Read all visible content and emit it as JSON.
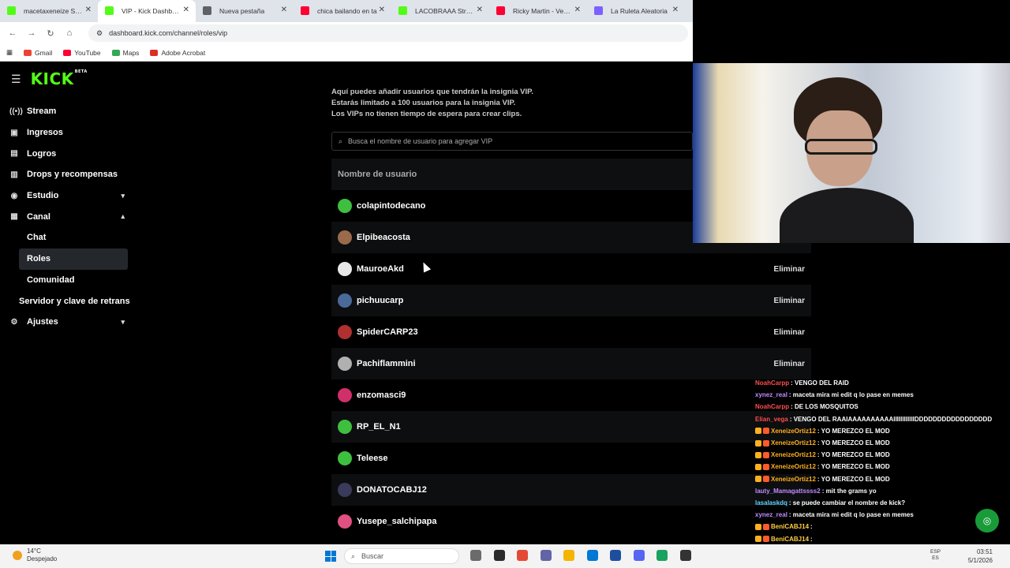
{
  "browser": {
    "tabs": [
      {
        "label": "macetaxeneize Stream",
        "favicon_color": "#53fc18",
        "active": false
      },
      {
        "label": "VIP - Kick Dashboard",
        "favicon_color": "#53fc18",
        "active": true
      },
      {
        "label": "Nueva pestaña",
        "favicon_color": "#5f6368",
        "active": false
      },
      {
        "label": "chica bailando en ta",
        "favicon_color": "#ff0033",
        "active": false
      },
      {
        "label": "LACOBRAAA Stream",
        "favicon_color": "#53fc18",
        "active": false
      },
      {
        "label": "Ricky Martin - Vente",
        "favicon_color": "#ff0033",
        "active": false
      },
      {
        "label": "La Ruleta Aleatoria",
        "favicon_color": "#7b61ff",
        "active": false
      }
    ],
    "close_glyph": "✕",
    "url": "dashboard.kick.com/channel/roles/vip",
    "bookmarks": [
      {
        "label": "Gmail",
        "color": "#ea4335"
      },
      {
        "label": "YouTube",
        "color": "#ff0033"
      },
      {
        "label": "Maps",
        "color": "#34a853"
      },
      {
        "label": "Adobe Acrobat",
        "color": "#d93025"
      }
    ]
  },
  "kick": {
    "logo": "KICK",
    "logo_sup": "BETA",
    "brand_color": "#53fc18",
    "sidebar": [
      {
        "label": "Stream",
        "icon": "broadcast-icon",
        "glyph": "((•))"
      },
      {
        "label": "Ingresos",
        "icon": "money-icon",
        "glyph": "▣"
      },
      {
        "label": "Logros",
        "icon": "trophy-icon",
        "glyph": "▤"
      },
      {
        "label": "Drops y recompensas",
        "icon": "gift-icon",
        "glyph": "▥"
      },
      {
        "label": "Estudio",
        "icon": "studio-icon",
        "glyph": "◉",
        "chevron": "▾"
      },
      {
        "label": "Canal",
        "icon": "channel-icon",
        "glyph": "▦",
        "chevron": "▴"
      }
    ],
    "canal_sub": [
      {
        "label": "Chat"
      },
      {
        "label": "Roles",
        "active": true
      },
      {
        "label": "Comunidad"
      }
    ],
    "server_item": "Servidor y clave de retrans",
    "settings_item": {
      "label": "Ajustes",
      "glyph": "⚙",
      "chevron": "▾"
    },
    "description": [
      "Aquí puedes añadir usuarios que tendrán la insignia VIP.",
      "Estarás limitado a 100 usuarios para la insignia VIP.",
      "Los VIPs no tienen tiempo de espera para crear clips."
    ],
    "search_placeholder": "Busca el nombre de usuario para agregar VIP",
    "column_header": "Nombre de usuario",
    "remove_label": "Eliminar",
    "users": [
      {
        "name": "colapintodecano",
        "avatar_color": "#3fbf3f"
      },
      {
        "name": "Elpibeacosta",
        "avatar_color": "#9a6a4a"
      },
      {
        "name": "MauroeAkd",
        "avatar_color": "#e8e8e8"
      },
      {
        "name": "pichuucarp",
        "avatar_color": "#4a6a9a"
      },
      {
        "name": "SpiderCARP23",
        "avatar_color": "#b03030"
      },
      {
        "name": "Pachiflammini",
        "avatar_color": "#b0b0b0"
      },
      {
        "name": "enzomasci9",
        "avatar_color": "#d0306a"
      },
      {
        "name": "RP_EL_N1",
        "avatar_color": "#3fbf3f"
      },
      {
        "name": "Teleese",
        "avatar_color": "#3fbf3f"
      },
      {
        "name": "DONATOCABJ12",
        "avatar_color": "#3a3a5a"
      },
      {
        "name": "Yusepe_salchipapa",
        "avatar_color": "#e05080"
      }
    ]
  },
  "chat": [
    {
      "user": "NoahCarpp",
      "user_color": "#ff4d4d",
      "text": ": VENGO DEL RAID",
      "badges": 0
    },
    {
      "user": "xynez_real",
      "user_color": "#c08cff",
      "text": ": maceta mira mi edit q lo pase en memes",
      "badges": 0
    },
    {
      "user": "NoahCarpp",
      "user_color": "#ff4d4d",
      "text": ": DE LOS MOSQUITOS",
      "badges": 0
    },
    {
      "user": "Elian_vega",
      "user_color": "#ff4d4d",
      "text": ": VENGO DEL RAAIAAAAAAAAAAIIIIIIIIIIIIDDDDDDDDDDDDDDDDD",
      "badges": 0
    },
    {
      "user": "XeneizeOrtiz12",
      "user_color": "#ffb020",
      "text": ": YO MEREZCO EL MOD",
      "badges": 2
    },
    {
      "user": "XeneizeOrtiz12",
      "user_color": "#ffb020",
      "text": ": YO MEREZCO EL MOD",
      "badges": 2
    },
    {
      "user": "XeneizeOrtiz12",
      "user_color": "#ffb020",
      "text": ": YO MEREZCO EL MOD",
      "badges": 2
    },
    {
      "user": "XeneizeOrtiz12",
      "user_color": "#ffb020",
      "text": ": YO MEREZCO EL MOD",
      "badges": 2
    },
    {
      "user": "XeneizeOrtiz12",
      "user_color": "#ffb020",
      "text": ": YO MEREZCO EL MOD",
      "badges": 2
    },
    {
      "user": "lauty_Mamagattssss2",
      "user_color": "#c08cff",
      "text": ": mit the grams yo",
      "badges": 0
    },
    {
      "user": "lasalaskdq",
      "user_color": "#5fd0ff",
      "text": ": se puede cambiar el nombre de kick?",
      "badges": 0
    },
    {
      "user": "xynez_real",
      "user_color": "#c08cff",
      "text": ": maceta mira mi edit q lo pase en memes",
      "badges": 0
    },
    {
      "user": "BeniCABJ14",
      "user_color": "#ffd040",
      "text": ":",
      "badges": 2
    },
    {
      "user": "BeniCABJ14",
      "user_color": "#ffd040",
      "text": ":",
      "badges": 2
    },
    {
      "user": "lasalaskdq",
      "user_color": "#5fd0ff",
      "text": ": se puede cambiar el nombre de kick?",
      "badges": 0
    },
    {
      "user": "xynez_real",
      "user_color": "#c08cff",
      "text": ": maceta mira mi edit q lo pase en memes",
      "badges": 0
    }
  ],
  "taskbar": {
    "temperature": "14°C",
    "weather": "Despejado",
    "search": "Buscar",
    "lang_top": "ESP",
    "lang_bottom": "ES",
    "time": "03:51",
    "date": "5/1/2026",
    "apps": [
      "#6b6b6b",
      "#2a2a2a",
      "#e24a36",
      "#6264a7",
      "#f4b400",
      "#0078d4",
      "#1e4e9e",
      "#5865f2",
      "#1aa260",
      "#333333"
    ]
  }
}
